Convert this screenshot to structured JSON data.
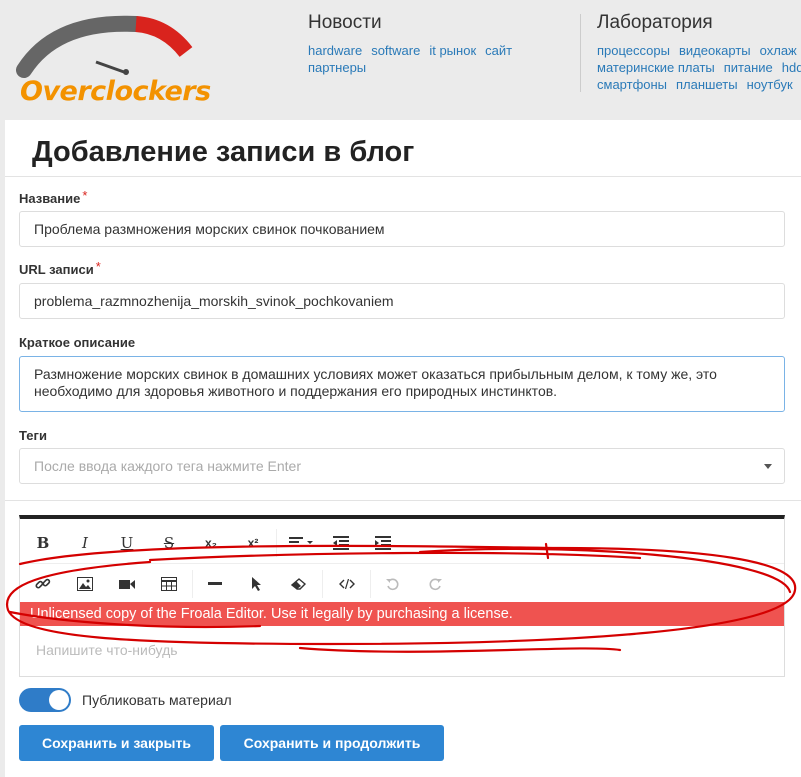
{
  "header": {
    "logo_text": "Overclockers",
    "news": {
      "title": "Новости",
      "links": [
        "hardware",
        "software",
        "it рынок",
        "сайт",
        "партнеры"
      ]
    },
    "lab": {
      "title": "Лаборатория",
      "row1": [
        "процессоры",
        "видеокарты",
        "охлаж"
      ],
      "row2": [
        "материнские платы",
        "питание",
        "hdd"
      ],
      "row3": [
        "смартфоны",
        "планшеты",
        "ноутбук"
      ]
    }
  },
  "page": {
    "title": "Добавление записи в блог"
  },
  "form": {
    "name_label": "Название",
    "name_value": "Проблема размножения морских свинок почкованием",
    "url_label": "URL записи",
    "url_value": "problema_razmnozhenija_morskih_svinok_pochkovaniem",
    "desc_label": "Краткое описание",
    "desc_value": "Размножение морских свинок в домашних условиях может оказаться прибыльным делом, к тому же, это необходимо для здоровья животного и поддержания его природных инстинктов.",
    "tags_label": "Теги",
    "tags_placeholder": "После ввода каждого тега нажмите Enter",
    "required_mark": "*"
  },
  "editor": {
    "toolbar_row1": {
      "bold": "B",
      "italic": "I",
      "underline": "U",
      "strike": "S",
      "subscript": "x₂",
      "superscript": "x²"
    },
    "banner": "Unlicensed copy of the Froala Editor. Use it legally by purchasing a license.",
    "placeholder": "Напишите что-нибудь"
  },
  "publish": {
    "label": "Публиковать материал",
    "enabled": true
  },
  "buttons": {
    "save_close": "Сохранить и закрыть",
    "save_continue": "Сохранить и продолжить"
  },
  "colors": {
    "accent": "#2e86d3",
    "banner": "#ef5350",
    "logo": "#f39200",
    "annotation": "#d40000"
  }
}
